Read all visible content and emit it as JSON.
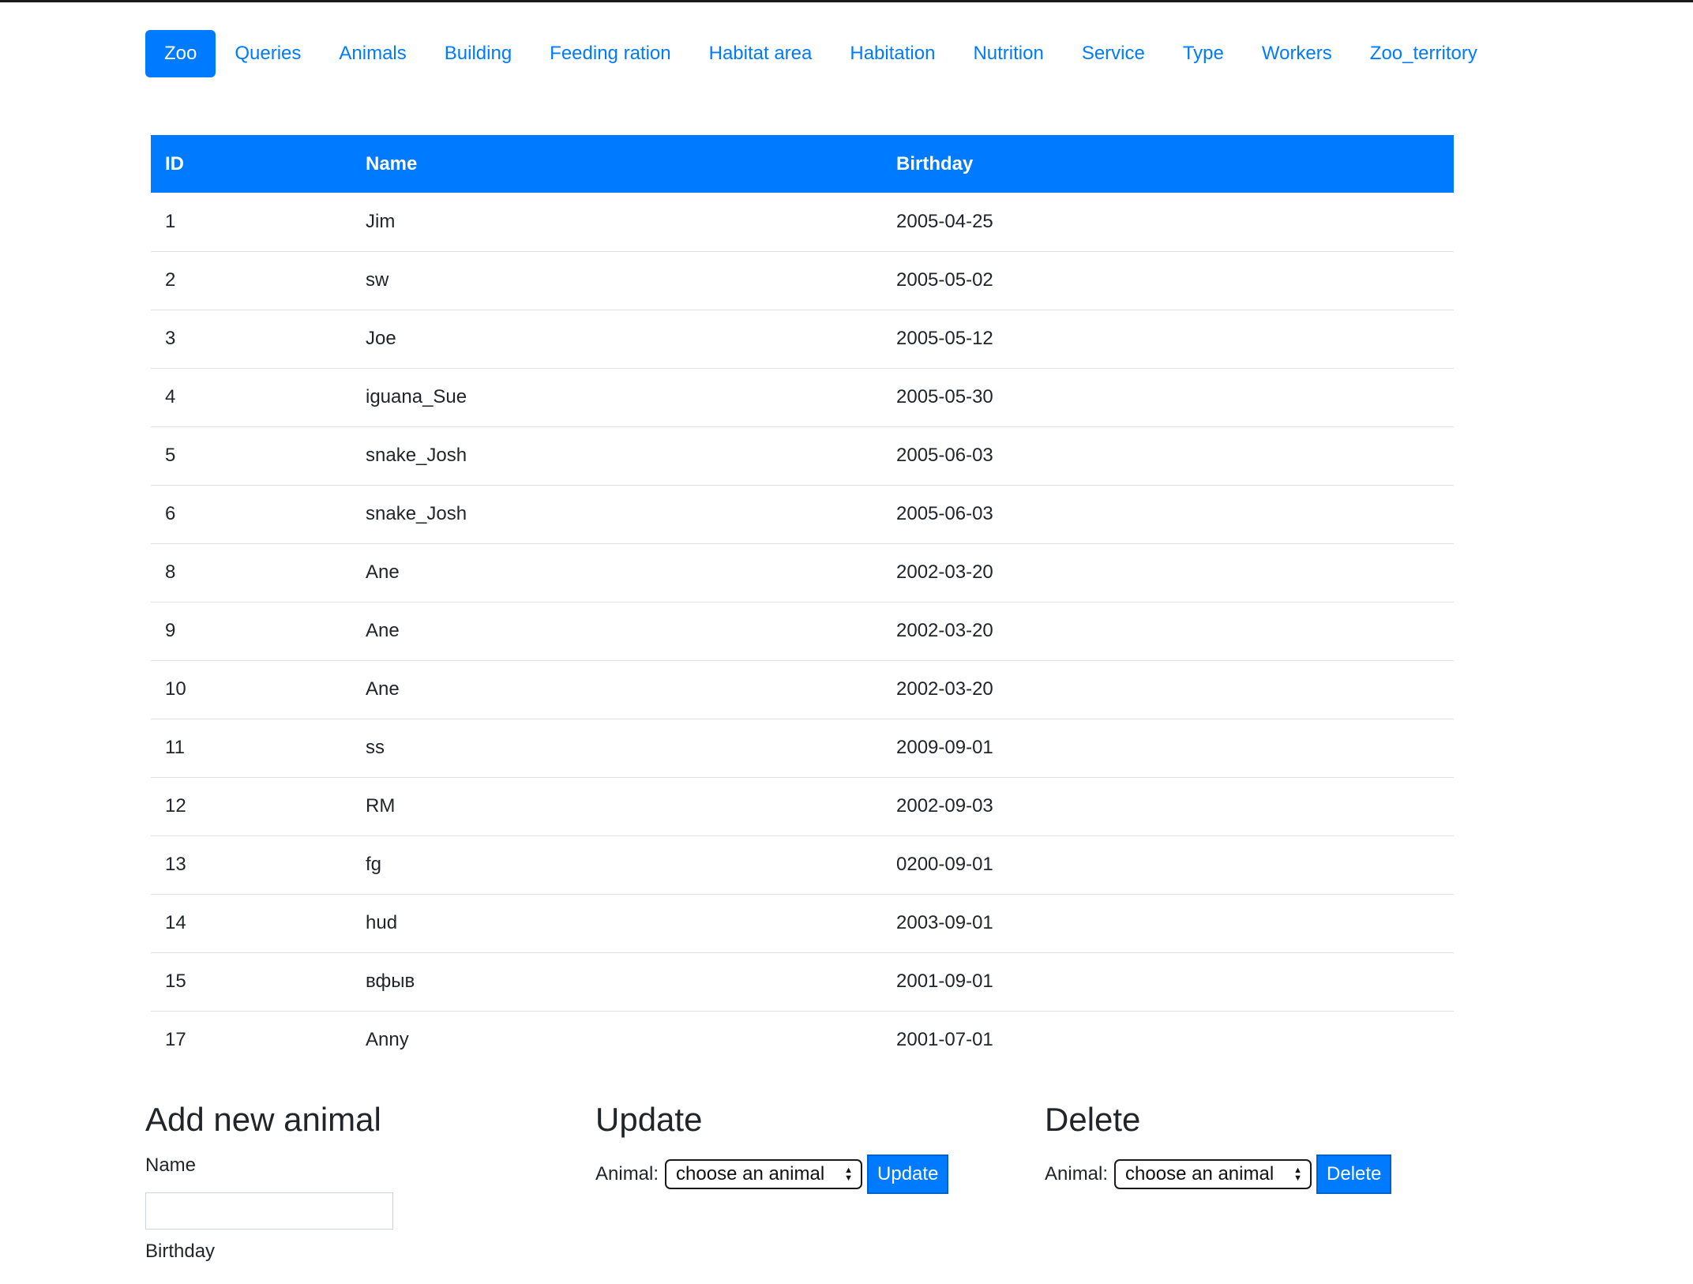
{
  "nav": {
    "items": [
      {
        "label": "Zoo",
        "active": true
      },
      {
        "label": "Queries"
      },
      {
        "label": "Animals"
      },
      {
        "label": "Building"
      },
      {
        "label": "Feeding ration"
      },
      {
        "label": "Habitat area"
      },
      {
        "label": "Habitation"
      },
      {
        "label": "Nutrition"
      },
      {
        "label": "Service"
      },
      {
        "label": "Type"
      },
      {
        "label": "Workers"
      },
      {
        "label": "Zoo_territory"
      }
    ]
  },
  "table": {
    "headers": [
      "ID",
      "Name",
      "Birthday"
    ],
    "rows": [
      [
        "1",
        "Jim",
        "2005-04-25"
      ],
      [
        "2",
        "sw",
        "2005-05-02"
      ],
      [
        "3",
        "Joe",
        "2005-05-12"
      ],
      [
        "4",
        "iguana_Sue",
        "2005-05-30"
      ],
      [
        "5",
        "snake_Josh",
        "2005-06-03"
      ],
      [
        "6",
        "snake_Josh",
        "2005-06-03"
      ],
      [
        "8",
        "Ane",
        "2002-03-20"
      ],
      [
        "9",
        "Ane",
        "2002-03-20"
      ],
      [
        "10",
        "Ane",
        "2002-03-20"
      ],
      [
        "11",
        "ss",
        "2009-09-01"
      ],
      [
        "12",
        "RM",
        "2002-09-03"
      ],
      [
        "13",
        "fg",
        "0200-09-01"
      ],
      [
        "14",
        "hud",
        "2003-09-01"
      ],
      [
        "15",
        "вфыв",
        "2001-09-01"
      ],
      [
        "17",
        "Anny",
        "2001-07-01"
      ]
    ]
  },
  "add_form": {
    "title": "Add new animal",
    "name_label": "Name",
    "name_value": "",
    "birthday_label": "Birthday"
  },
  "update_form": {
    "title": "Update",
    "animal_label": "Animal:",
    "select_value": "choose an animal",
    "button_label": "Update"
  },
  "delete_form": {
    "title": "Delete",
    "animal_label": "Animal:",
    "select_value": "choose an animal",
    "button_label": "Delete"
  },
  "colors": {
    "accent": "#007bff",
    "text": "#212529",
    "row_border": "#dee2e6"
  }
}
